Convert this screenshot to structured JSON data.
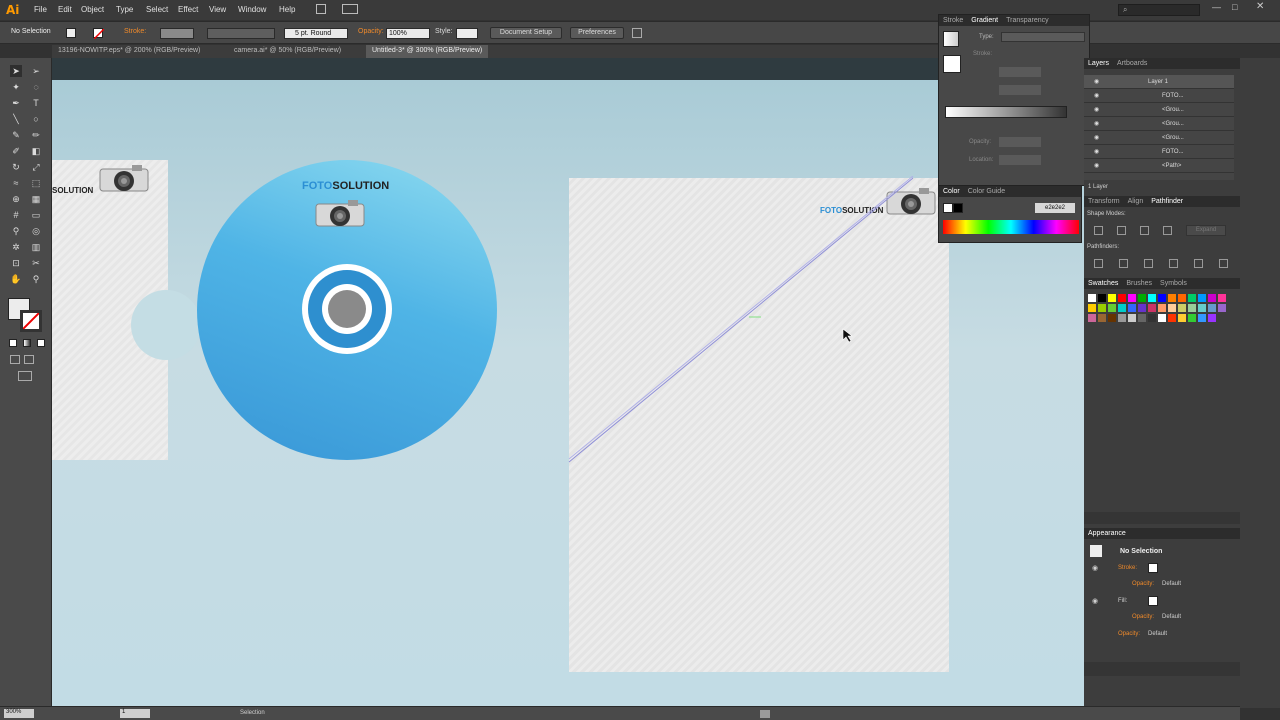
{
  "app": {
    "logo": "Ai"
  },
  "menu": [
    "File",
    "Edit",
    "Object",
    "Type",
    "Select",
    "Effect",
    "View",
    "Window",
    "Help"
  ],
  "control": {
    "selection_label": "No Selection",
    "stroke_label": "Stroke:",
    "brush_value": "5 pt. Round",
    "opacity_label": "Opacity:",
    "opacity_value": "100%",
    "style_label": "Style:",
    "doc_setup": "Document Setup",
    "preferences": "Preferences"
  },
  "tabs": [
    {
      "label": "13196-NOWITP.eps* @ 200% (RGB/Preview)"
    },
    {
      "label": "camera.ai* @ 50% (RGB/Preview)"
    },
    {
      "label": "Untitled-3* @ 300% (RGB/Preview)"
    }
  ],
  "canvas": {
    "brand_left": "SOLUTION",
    "brand_foto": "FOTO",
    "brand_solution": "SOLUTION"
  },
  "gradient_panel": {
    "tabs": [
      "Stroke",
      "Gradient",
      "Transparency"
    ],
    "type_label": "Type:",
    "stroke_label": "Stroke:",
    "opacity_label": "Opacity:",
    "location_label": "Location:"
  },
  "color_panel": {
    "tabs": [
      "Color",
      "Color Guide"
    ],
    "hex": "e2e2e2"
  },
  "layers_panel": {
    "tabs": [
      "Layers",
      "Artboards"
    ],
    "rows": [
      "Layer 1",
      "FOTO...",
      "<Grou...",
      "<Grou...",
      "<Grou...",
      "FOTO...",
      "<Path>",
      "<Path>"
    ],
    "footer": "1 Layer"
  },
  "pathfinder_panel": {
    "tabs": [
      "Transform",
      "Align",
      "Pathfinder"
    ],
    "shape_modes": "Shape Modes:",
    "expand": "Expand",
    "pathfinders": "Pathfinders:"
  },
  "swatches_panel": {
    "tabs": [
      "Swatches",
      "Brushes",
      "Symbols"
    ],
    "colors": [
      "#ffffff",
      "#000000",
      "#ffff00",
      "#ff0000",
      "#ff00ff",
      "#00aa00",
      "#00ffff",
      "#0000ff",
      "#ff7f00",
      "#ff6600",
      "#00cc66",
      "#0099ff",
      "#cc00cc",
      "#ff3399",
      "#ffcc00",
      "#99cc00",
      "#66cc33",
      "#00cccc",
      "#3366ff",
      "#6633cc",
      "#cc3366",
      "#ff9966",
      "#ffcc99",
      "#cccc66",
      "#99cc99",
      "#66cccc",
      "#6699cc",
      "#9966cc",
      "#cc6699",
      "#996633",
      "#663300",
      "#999999",
      "#cccccc",
      "#666666",
      "#333333",
      "#ffffff",
      "#ff3300",
      "#ffcc33",
      "#33cc33",
      "#3399ff",
      "#9933ff"
    ]
  },
  "appearance_panel": {
    "title": "Appearance",
    "selection": "No Selection",
    "stroke": "Stroke:",
    "opacity1": "Opacity:",
    "default1": "Default",
    "fill": "Fill:",
    "opacity2": "Opacity:",
    "default2": "Default",
    "opacity3": "Opacity:",
    "default3": "Default"
  },
  "status": {
    "zoom": "300%",
    "page": "1",
    "tool": "Selection"
  }
}
